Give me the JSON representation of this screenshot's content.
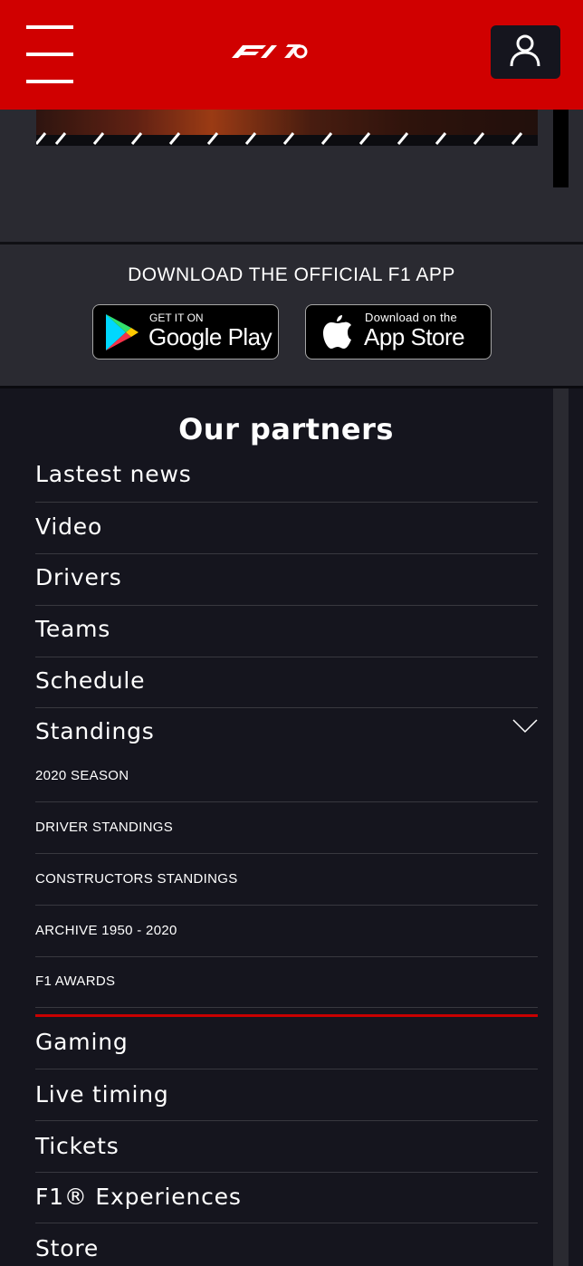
{
  "header": {
    "logo_icon": "f1-logo",
    "menu_icon": "hamburger-icon",
    "account_icon": "user-icon"
  },
  "app_download": {
    "title": "DOWNLOAD THE OFFICIAL F1 APP",
    "google": {
      "small": "GET IT ON",
      "big": "Google Play"
    },
    "apple": {
      "small": "Download on the",
      "big": "App Store"
    }
  },
  "menu": {
    "title": "Our partners",
    "items_top": [
      "Lastest news",
      "Video",
      "Drivers",
      "Teams",
      "Schedule",
      "Standings"
    ],
    "standings_sub": [
      "2020 SEASON",
      "DRIVER STANDINGS",
      "CONSTRUCTORS STANDINGS",
      "ARCHIVE 1950 - 2020",
      "F1 AWARDS"
    ],
    "items_bottom": [
      "Gaming",
      "Live timing",
      "Tickets",
      "F1® Experiences",
      "Store"
    ]
  },
  "colors": {
    "brand_red": "#d00000",
    "background": "#15151e",
    "panel": "#2a2a31"
  }
}
